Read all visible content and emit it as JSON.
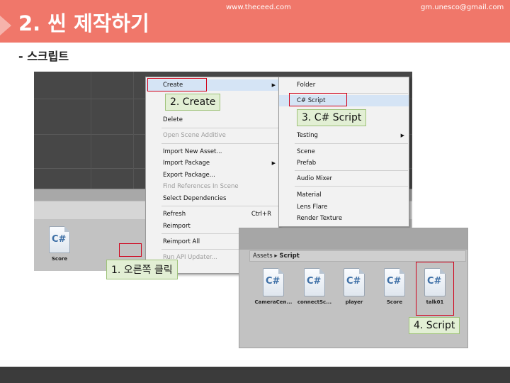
{
  "slide": {
    "title": "2. 씬 제작하기",
    "subtitle": "- 스크립트"
  },
  "editor": {
    "assets": [
      {
        "label": "Score",
        "icon": "csharp-file-icon",
        "glyph": "C#"
      }
    ]
  },
  "context_menu": {
    "items": [
      {
        "label": "Create",
        "submenu": true,
        "highlighted": true
      },
      {
        "label": "Delete"
      },
      {
        "label": "Open Scene Additive",
        "disabled": true
      },
      {
        "label": "Import New Asset..."
      },
      {
        "label": "Import Package",
        "submenu": true
      },
      {
        "label": "Export Package..."
      },
      {
        "label": "Find References In Scene",
        "disabled": true
      },
      {
        "label": "Select Dependencies"
      },
      {
        "label": "Refresh",
        "shortcut": "Ctrl+R"
      },
      {
        "label": "Reimport"
      },
      {
        "label": "Reimport All"
      },
      {
        "label": "Run API Updater...",
        "disabled": true
      }
    ]
  },
  "create_submenu": {
    "items": [
      {
        "label": "Folder"
      },
      {
        "label": "C# Script",
        "highlighted": true
      },
      {
        "label": "Testing",
        "submenu": true
      },
      {
        "label": "Scene"
      },
      {
        "label": "Prefab"
      },
      {
        "label": "Audio Mixer"
      },
      {
        "label": "Material"
      },
      {
        "label": "Lens Flare"
      },
      {
        "label": "Render Texture"
      }
    ]
  },
  "project_window": {
    "breadcrumb_root": "Assets",
    "breadcrumb_separator": "▸",
    "breadcrumb_current": "Script",
    "assets": [
      {
        "label": "CameraCen...",
        "glyph": "C#"
      },
      {
        "label": "connectSc...",
        "glyph": "C#"
      },
      {
        "label": "player",
        "glyph": "C#"
      },
      {
        "label": "Score",
        "glyph": "C#"
      },
      {
        "label": "talk01",
        "glyph": "C#"
      }
    ]
  },
  "callouts": {
    "step1": "1. 오른쪽 클릭",
    "step2": "2. Create",
    "step3": "3. C# Script",
    "step4": "4. Script"
  },
  "footer": {
    "website": "www.theceed.com",
    "email": "gm.unesco@gmail.com"
  },
  "colors": {
    "header": "#f0776a",
    "callout_bg": "#e2efd4",
    "highlight_box": "#d0021b",
    "footer": "#3b3b3b"
  }
}
